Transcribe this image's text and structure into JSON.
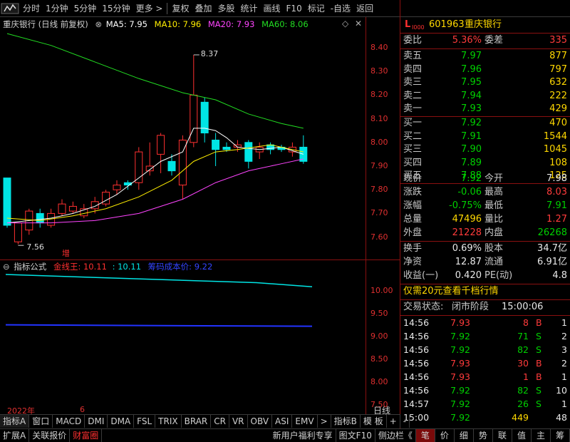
{
  "toolbar": {
    "periods": [
      "分时",
      "1分钟",
      "5分钟",
      "15分钟",
      "更多 >"
    ],
    "actions": [
      "复权",
      "叠加",
      "多股",
      "统计",
      "画线",
      "F10",
      "标记",
      "-自选",
      "返回"
    ]
  },
  "header": {
    "flag": "L",
    "flag_sub": "I000",
    "code": "601963",
    "name": "重庆银行"
  },
  "main_chart": {
    "title": "重庆银行 (日线 前复权)",
    "ma5_label": "MA5: 7.95",
    "ma10_label": "MA10: 7.96",
    "ma20_label": "MA20: 7.93",
    "ma60_label": "MA60: 8.06",
    "high_label": "8.37",
    "low_label": "7.56",
    "marker": "增",
    "y_ticks": [
      "8.40",
      "8.30",
      "8.20",
      "8.10",
      "8.00",
      "7.90",
      "7.80",
      "7.70",
      "7.60"
    ],
    "colors": {
      "up": "#ff3030",
      "down": "#00e5e5",
      "ma5": "#ffffff",
      "ma10": "#ffee00",
      "ma20": "#ff44ff",
      "ma60": "#22dd22"
    }
  },
  "indicator": {
    "title": "指标公式",
    "line1_label": "金线王: 10.11",
    "line1b_label": ": 10.11",
    "line2_label": "筹码成本价: 9.22",
    "y_ticks": [
      "10.00",
      "9.50",
      "9.00",
      "8.50",
      "8.00",
      "7.50"
    ],
    "x_year": "2022年",
    "x_month": "6",
    "mode": "日线"
  },
  "quote": {
    "webi_label": "委比",
    "webi_value": "5.36%",
    "wecha_label": "委差",
    "wecha_value": "335",
    "asks": [
      {
        "label": "卖五",
        "price": "7.97",
        "vol": "877"
      },
      {
        "label": "卖四",
        "price": "7.96",
        "vol": "797"
      },
      {
        "label": "卖三",
        "price": "7.95",
        "vol": "632"
      },
      {
        "label": "卖二",
        "price": "7.94",
        "vol": "222"
      },
      {
        "label": "卖一",
        "price": "7.93",
        "vol": "429"
      }
    ],
    "bids": [
      {
        "label": "买一",
        "price": "7.92",
        "vol": "470"
      },
      {
        "label": "买二",
        "price": "7.91",
        "vol": "1544"
      },
      {
        "label": "买三",
        "price": "7.90",
        "vol": "1045"
      },
      {
        "label": "买四",
        "price": "7.89",
        "vol": "108"
      },
      {
        "label": "买五",
        "price": "7.88",
        "vol": "125"
      }
    ],
    "stats": [
      {
        "l1": "现价",
        "v1": "7.92",
        "c1": "g",
        "l2": "今开",
        "v2": "7.98",
        "c2": "w"
      },
      {
        "l1": "涨跌",
        "v1": "-0.06",
        "c1": "g",
        "l2": "最高",
        "v2": "8.03",
        "c2": "r"
      },
      {
        "l1": "涨幅",
        "v1": "-0.75%",
        "c1": "g",
        "l2": "最低",
        "v2": "7.91",
        "c2": "g"
      },
      {
        "l1": "总量",
        "v1": "47496",
        "c1": "y",
        "l2": "量比",
        "v2": "1.27",
        "c2": "r"
      },
      {
        "l1": "外盘",
        "v1": "21228",
        "c1": "r",
        "l2": "内盘",
        "v2": "26268",
        "c2": "g"
      }
    ],
    "stats2": [
      {
        "l1": "换手",
        "v1": "0.69%",
        "l2": "股本",
        "v2": "34.7亿"
      },
      {
        "l1": "净资",
        "v1": "12.87",
        "l2": "流通",
        "v2": "6.91亿"
      },
      {
        "l1": "收益(一)",
        "v1": "0.420",
        "l2": "PE(动)",
        "v2": "4.8"
      }
    ],
    "promo": "仅需20元查看千档行情",
    "status_label": "交易状态:",
    "status_value": "闭市阶段",
    "status_time": "15:00:06"
  },
  "ticks": [
    {
      "t": "14:56",
      "p": "7.93",
      "v": "8",
      "d": "B",
      "n": "1"
    },
    {
      "t": "14:56",
      "p": "7.92",
      "v": "71",
      "d": "S",
      "n": "2"
    },
    {
      "t": "14:56",
      "p": "7.92",
      "v": "82",
      "d": "S",
      "n": "3"
    },
    {
      "t": "14:56",
      "p": "7.93",
      "v": "30",
      "d": "B",
      "n": "2"
    },
    {
      "t": "14:56",
      "p": "7.93",
      "v": "1",
      "d": "B",
      "n": "1"
    },
    {
      "t": "14:56",
      "p": "7.92",
      "v": "82",
      "d": "S",
      "n": "10"
    },
    {
      "t": "14:57",
      "p": "7.92",
      "v": "26",
      "d": "S",
      "n": "1"
    },
    {
      "t": "15:00",
      "p": "7.92",
      "v": "449",
      "d": "",
      "n": "48"
    }
  ],
  "bottom_tabs": [
    "指标A",
    "窗口",
    "MACD",
    "DMI",
    "DMA",
    "FSL",
    "TRIX",
    "BRAR",
    "CR",
    "VR",
    "OBV",
    "ASI",
    "EMV",
    ">"
  ],
  "bottom_tabs_right": [
    "指标B",
    "模 板",
    "+",
    "-"
  ],
  "status_tabs": [
    "扩展A",
    "关联报价",
    "财富圈"
  ],
  "status_right": [
    "新用户福利专享",
    "图文F10",
    "侧边栏《",
    "笔",
    "价",
    "细",
    "势",
    "联",
    "值",
    "主",
    "筹"
  ]
}
